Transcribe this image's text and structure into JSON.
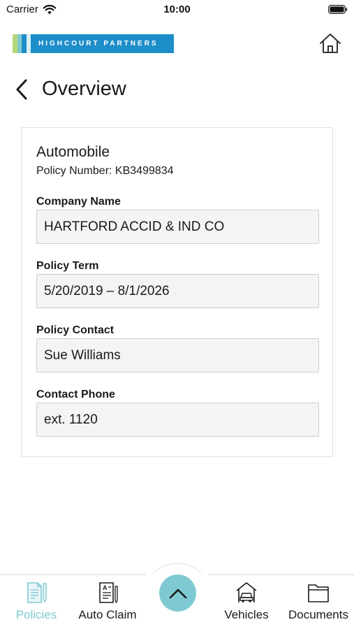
{
  "status_bar": {
    "carrier": "Carrier",
    "time": "10:00"
  },
  "header": {
    "logo_text": "HIGHCOURT PARTNERS",
    "logo_colors": [
      "#b6d77a",
      "#7fcad2",
      "#1e8ec9",
      "#d9eef4"
    ],
    "brand_color": "#1e8ec9",
    "home_icon": "home-icon"
  },
  "page": {
    "title": "Overview",
    "back_icon": "chevron-left-icon"
  },
  "policy": {
    "type": "Automobile",
    "number_text": "Policy Number: KB3499834",
    "fields": [
      {
        "label": "Company Name",
        "value": "HARTFORD ACCID & IND CO"
      },
      {
        "label": "Policy Term",
        "value": "5/20/2019 – 8/1/2026"
      },
      {
        "label": "Policy Contact",
        "value": "Sue Williams"
      },
      {
        "label": "Contact Phone",
        "value": "ext. 1120"
      }
    ]
  },
  "tab_bar": {
    "accent_color": "#7fcad2",
    "tabs": [
      {
        "label": "Policies",
        "icon": "policy-document-icon",
        "active": true
      },
      {
        "label": "Auto Claim",
        "icon": "claim-form-icon",
        "active": false
      },
      {
        "label": "Vehicles",
        "icon": "car-garage-icon",
        "active": false
      },
      {
        "label": "Documents",
        "icon": "folder-icon",
        "active": false
      }
    ],
    "center_icon": "chevron-up-icon"
  }
}
